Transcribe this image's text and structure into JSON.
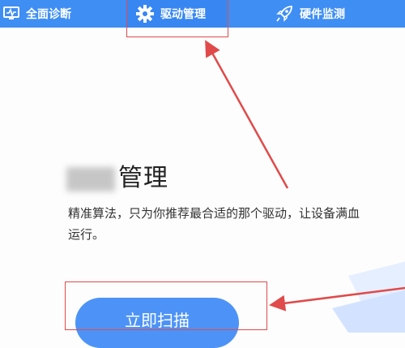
{
  "nav": {
    "tabs": [
      {
        "label": "全面诊断",
        "icon": "monitor-diagnosis-icon"
      },
      {
        "label": "驱动管理",
        "icon": "gear-icon"
      },
      {
        "label": "硬件监测",
        "icon": "rocket-icon"
      }
    ],
    "active_tab": "驱动管理"
  },
  "main": {
    "title_visible": "管理",
    "description": "精准算法，只为你推荐最合适的那个驱动，让设备满血运行。",
    "scan_button": "立即扫描"
  },
  "colors": {
    "nav_bg": "#3f8ef4",
    "button": "#4d93f7",
    "annotation_red": "#e04a4a"
  }
}
